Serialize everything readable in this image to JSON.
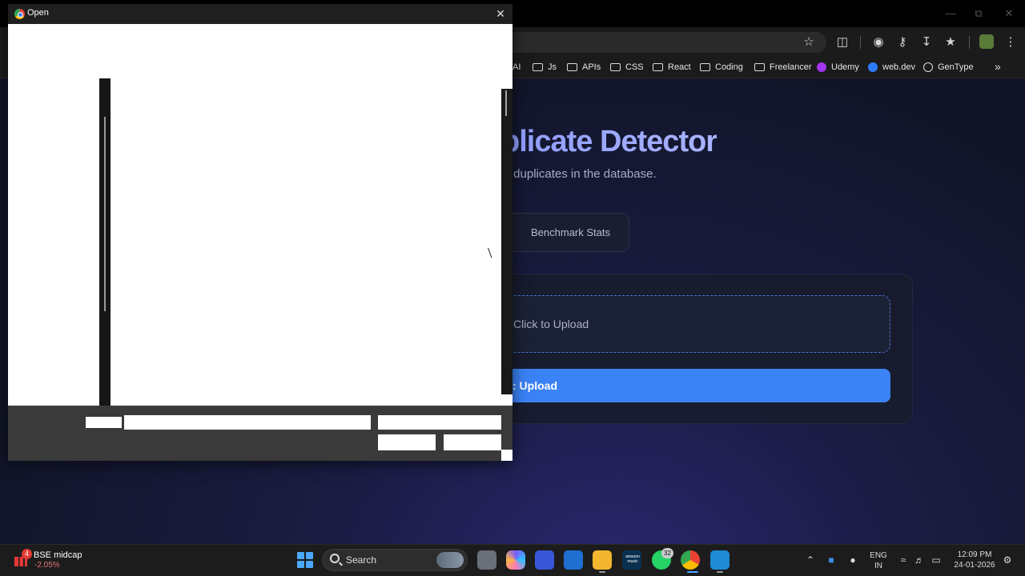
{
  "bookmarks": {
    "items": [
      "AI",
      "Js",
      "APIs",
      "CSS",
      "React",
      "Coding",
      "Freelancer",
      "Udemy",
      "web.dev",
      "GenType"
    ]
  },
  "page": {
    "title": "plicate Detector",
    "subtitle": "r duplicates in the database.",
    "stats_button": "Benchmark Stats",
    "dropzone_label": "Click to Upload",
    "upload_button": ": Upload"
  },
  "dialog": {
    "title": "Open"
  },
  "taskbar": {
    "widget": {
      "name": "BSE midcap",
      "change": "-2.05%",
      "badge": "4"
    },
    "search_label": "Search",
    "whatsapp_badge": "32",
    "amazon_music_label": "amazon music",
    "language": [
      "ENG",
      "IN"
    ],
    "clock": {
      "time": "12:09 PM",
      "date": "24-01-2026"
    }
  },
  "colors": {
    "accent": "#3b82f6",
    "dropzone_border": "#4a72d6",
    "title_gradient_start": "#8f9cff",
    "badge_red": "#e53935"
  },
  "icons": [
    "star-icon",
    "extensions-icon",
    "incognito-icon",
    "key-icon",
    "download-icon",
    "bookmark-star-icon",
    "menu-icon",
    "chrome-icon",
    "close-icon",
    "windows-start-icon",
    "search-icon",
    "wifi-icon",
    "volume-icon",
    "battery-icon"
  ]
}
